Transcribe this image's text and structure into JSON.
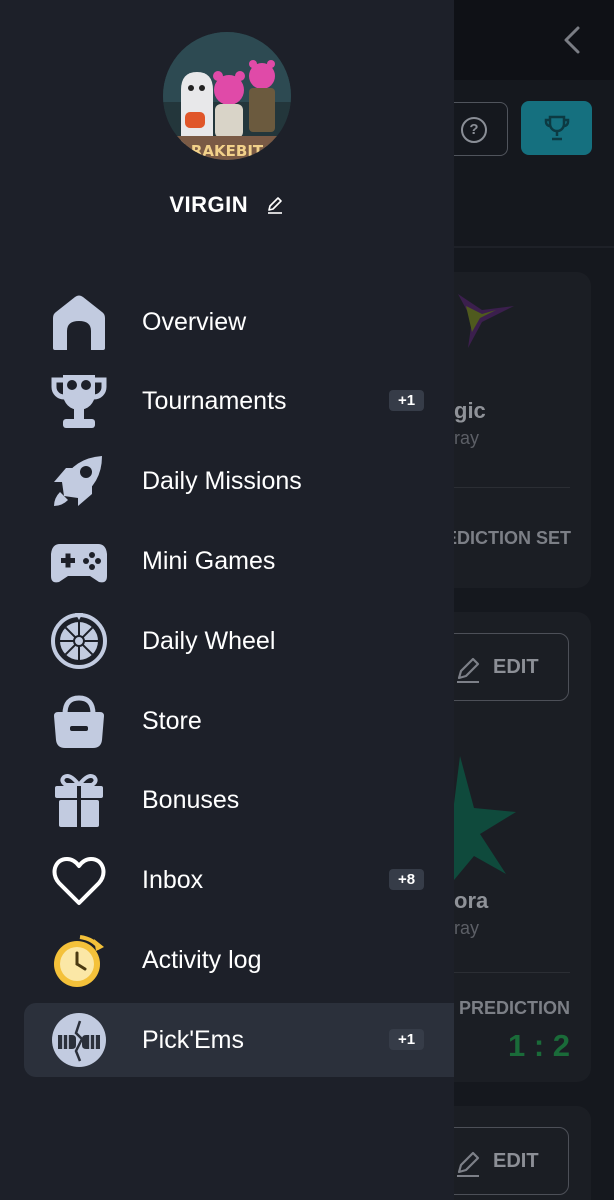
{
  "user": {
    "name": "VIRGIN",
    "avatar_text": "RAKEBIT"
  },
  "menu": [
    {
      "id": "overview",
      "label": "Overview",
      "icon": "home-icon",
      "badge": ""
    },
    {
      "id": "tournaments",
      "label": "Tournaments",
      "icon": "trophy-icon",
      "badge": "+1"
    },
    {
      "id": "daily-missions",
      "label": "Daily Missions",
      "icon": "rocket-icon",
      "badge": ""
    },
    {
      "id": "mini-games",
      "label": "Mini Games",
      "icon": "gamepad-icon",
      "badge": ""
    },
    {
      "id": "daily-wheel",
      "label": "Daily Wheel",
      "icon": "wheel-icon",
      "badge": ""
    },
    {
      "id": "store",
      "label": "Store",
      "icon": "basket-icon",
      "badge": ""
    },
    {
      "id": "bonuses",
      "label": "Bonuses",
      "icon": "gift-icon",
      "badge": ""
    },
    {
      "id": "inbox",
      "label": "Inbox",
      "icon": "heart-icon",
      "badge": "+8"
    },
    {
      "id": "activity-log",
      "label": "Activity log",
      "icon": "clock-icon",
      "badge": ""
    },
    {
      "id": "pickems",
      "label": "Pick'Ems",
      "icon": "handshake-icon",
      "badge": "+1"
    }
  ],
  "active_item": "pickems",
  "background": {
    "card1": {
      "team": "gic",
      "subtitle": "ray",
      "status": "EDICTION SET"
    },
    "card2": {
      "edit_label": "EDIT",
      "team": "ora",
      "subtitle": "ray",
      "prediction_label": "PREDICTION",
      "score": "1 : 2"
    },
    "card3": {
      "edit_label": "EDIT"
    }
  },
  "colors": {
    "drawer_bg": "#1d2029",
    "active_bg": "#2b303b",
    "icon_color": "#c2cbe0",
    "badge_bg": "#363c48",
    "accent_teal": "#15707f",
    "score_green": "#1a6b39"
  }
}
